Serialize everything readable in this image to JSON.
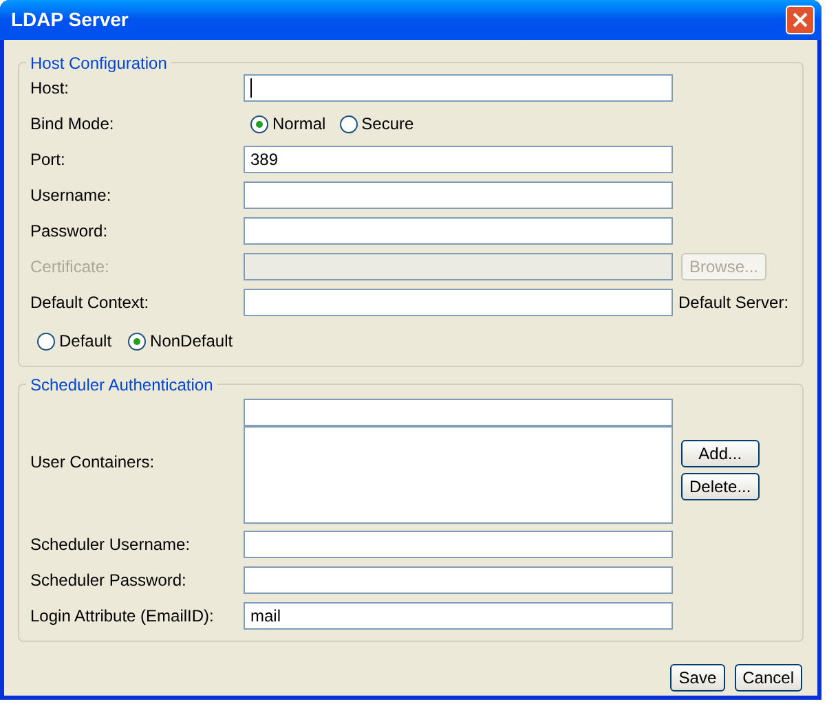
{
  "window": {
    "title": "LDAP Server"
  },
  "host_configuration": {
    "title": "Host Configuration",
    "rows": [
      {
        "kind": "text",
        "label": "Host:",
        "focused": true
      },
      {
        "kind": "radio",
        "label": "Bind Mode:",
        "options": [
          {
            "label": "Normal",
            "selected": true
          },
          {
            "label": "Secure",
            "selected": false
          }
        ]
      },
      {
        "kind": "text",
        "label": "Port:",
        "value": "389"
      },
      {
        "kind": "text",
        "label": "Username:"
      },
      {
        "kind": "text",
        "label": "Password:"
      },
      {
        "kind": "text",
        "label": "Certificate:",
        "disabled": true,
        "button": {
          "label": "Browse...",
          "disabled": true
        }
      },
      {
        "kind": "text",
        "label": "Default Context:",
        "suffix": "Default Server:"
      },
      {
        "kind": "radio",
        "options": [
          {
            "label": "Default",
            "selected": false
          },
          {
            "label": "NonDefault",
            "selected": true
          }
        ]
      }
    ]
  },
  "scheduler_authentication": {
    "title": "Scheduler Authentication",
    "rows": [
      {
        "kind": "list",
        "label": "User Containers:",
        "buttons": [
          {
            "label": "Add..."
          },
          {
            "label": "Delete..."
          }
        ]
      },
      {
        "kind": "text",
        "label": "Scheduler Username:"
      },
      {
        "kind": "text",
        "label": "Scheduler Password:"
      },
      {
        "kind": "text",
        "label": "Login Attribute (EmailID):",
        "value": "mail"
      }
    ]
  },
  "buttons": [
    {
      "label": "Save"
    },
    {
      "label": "Cancel"
    }
  ]
}
